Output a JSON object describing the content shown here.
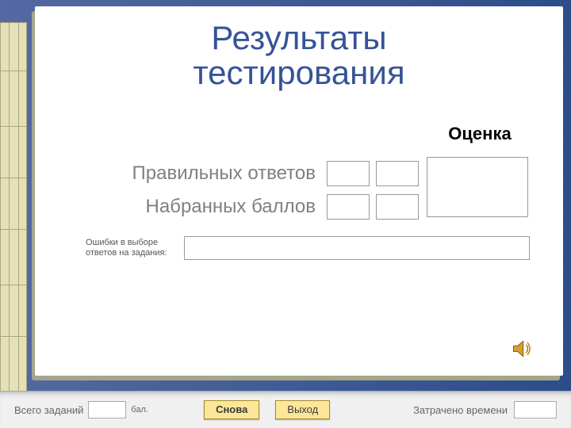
{
  "title_line1": "Результаты",
  "title_line2": "тестирования",
  "grade_header": "Оценка",
  "row1_label": "Правильных ответов",
  "row1_value_a": "",
  "row1_value_b": "",
  "row2_label": "Набранных баллов",
  "row2_value_a": "",
  "row2_value_b": "",
  "grade_value": "",
  "err_label": "Ошибки в выборе ответов на задания:",
  "err_value": "",
  "footer": {
    "total_label": "Всего заданий",
    "total_value": "",
    "unit": "бал.",
    "again": "Снова",
    "exit": "Выход",
    "time_label": "Затрачено времени",
    "time_value": ""
  }
}
